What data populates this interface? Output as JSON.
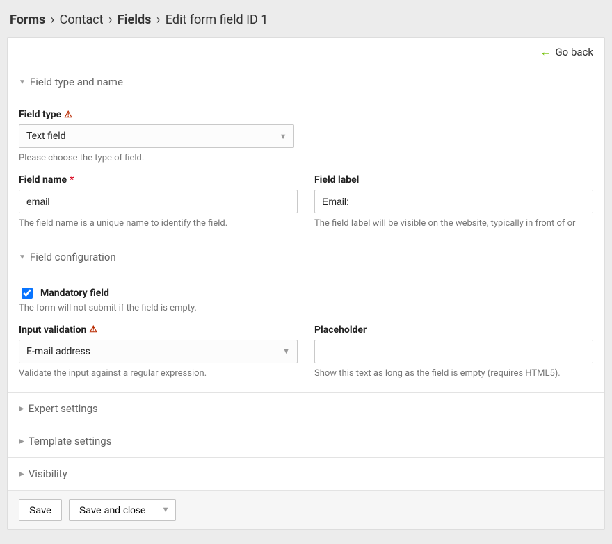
{
  "breadcrumb": {
    "items": [
      "Forms",
      "Contact",
      "Fields"
    ],
    "current": "Edit form field ID 1"
  },
  "topbar": {
    "go_back": "Go back"
  },
  "sections": {
    "type_name": {
      "title": "Field type and name",
      "field_type": {
        "label": "Field type",
        "value": "Text field",
        "help": "Please choose the type of field."
      },
      "field_name": {
        "label": "Field name",
        "value": "email",
        "help": "The field name is a unique name to identify the field."
      },
      "field_label": {
        "label": "Field label",
        "value": "Email:",
        "help": "The field label will be visible on the website, typically in front of or"
      }
    },
    "config": {
      "title": "Field configuration",
      "mandatory": {
        "label": "Mandatory field",
        "checked": true,
        "help": "The form will not submit if the field is empty."
      },
      "validation": {
        "label": "Input validation",
        "value": "E-mail address",
        "help": "Validate the input against a regular expression."
      },
      "placeholder": {
        "label": "Placeholder",
        "value": "",
        "help": "Show this text as long as the field is empty (requires HTML5)."
      }
    },
    "expert": {
      "title": "Expert settings"
    },
    "template": {
      "title": "Template settings"
    },
    "visibility": {
      "title": "Visibility"
    }
  },
  "footer": {
    "save": "Save",
    "save_close": "Save and close"
  }
}
